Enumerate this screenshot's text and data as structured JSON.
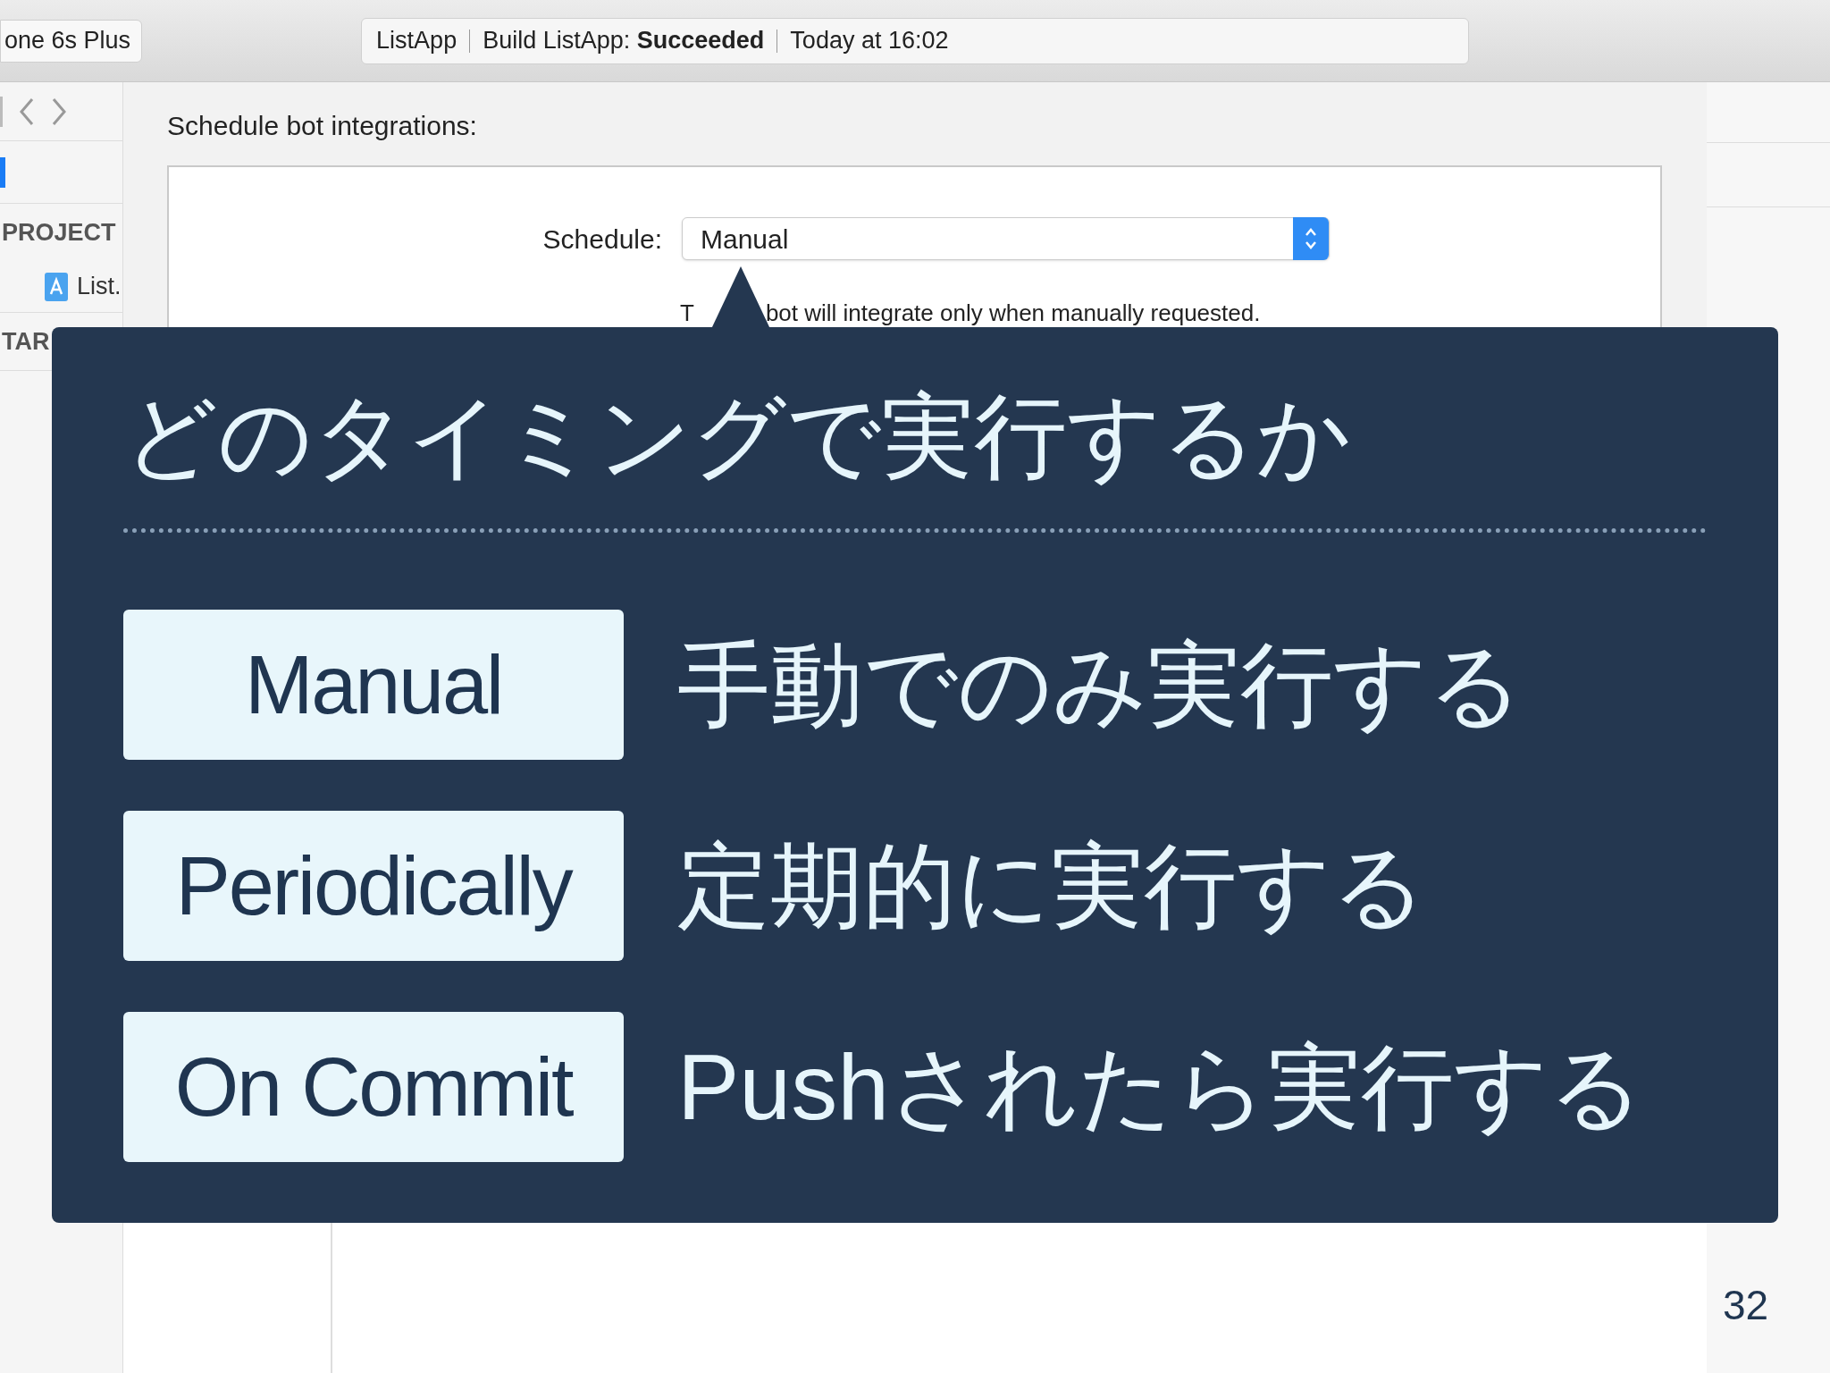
{
  "toolbar": {
    "device": "one 6s Plus",
    "activity": {
      "project": "ListApp",
      "build_label": "Build ListApp:",
      "build_status": "Succeeded",
      "time": "Today at 16:02"
    }
  },
  "sidebar": {
    "sections": [
      {
        "title": "PROJECT",
        "items": [
          {
            "label": "List."
          }
        ]
      },
      {
        "title": "TAR"
      }
    ]
  },
  "main": {
    "heading": "Schedule bot integrations:",
    "schedule_label": "Schedule:",
    "schedule_value": "Manual",
    "description_parts": [
      "T",
      "bot will integrate only when manually requested."
    ]
  },
  "callout": {
    "title": "どのタイミングで実行するか",
    "options": [
      {
        "name": "Manual",
        "description": "手動でのみ実行する"
      },
      {
        "name": "Periodically",
        "description": "定期的に実行する"
      },
      {
        "name": "On Commit",
        "description": "Pushされたら実行する"
      }
    ]
  },
  "page_number": "32"
}
